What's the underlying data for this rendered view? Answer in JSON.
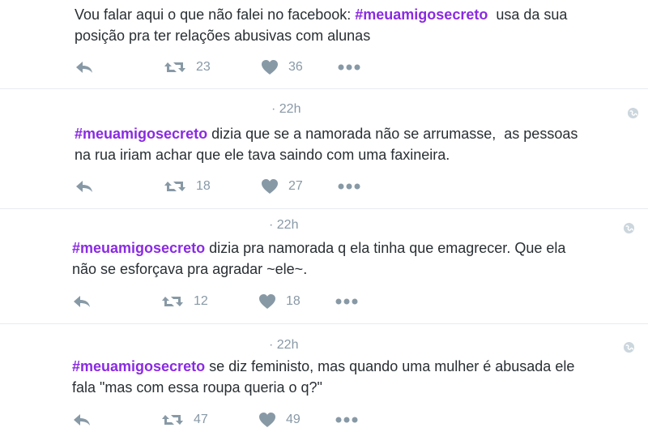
{
  "tweets": [
    {
      "time": "",
      "hashtag": "",
      "lead": "Vou falar aqui o que não falei no facebook: ",
      "tag_mid": "#meuamigosecreto",
      "rest": "  usa da sua\nposição pra ter relações abusivas com alunas",
      "retweets": "23",
      "likes": "36"
    },
    {
      "time": "· 22h",
      "hashtag": "#meuamigosecreto",
      "rest": " dizia que se a namorada não se arrumasse,  as pessoas\nna rua iriam achar que ele tava saindo com uma faxineira.",
      "retweets": "18",
      "likes": "27"
    },
    {
      "time": "· 22h",
      "hashtag": "#meuamigosecreto",
      "rest": " dizia pra namorada q ela tinha que emagrecer. Que ela\nnão se esforçava pra agradar ~ele~.",
      "retweets": "12",
      "likes": "18"
    },
    {
      "time": "· 22h",
      "hashtag": "#meuamigosecreto",
      "rest": " se diz feministo, mas quando uma mulher é abusada ele\nfala \"mas com essa roupa queria o q?\"",
      "retweets": "47",
      "likes": "49"
    }
  ],
  "icons": {
    "reply": "reply-icon",
    "retweet": "retweet-icon",
    "like": "heart-icon",
    "more": "more-icon",
    "globe": "globe-icon"
  },
  "colors": {
    "hashtag": "#8a2be2",
    "muted": "#8899a6",
    "text": "#292f33"
  }
}
